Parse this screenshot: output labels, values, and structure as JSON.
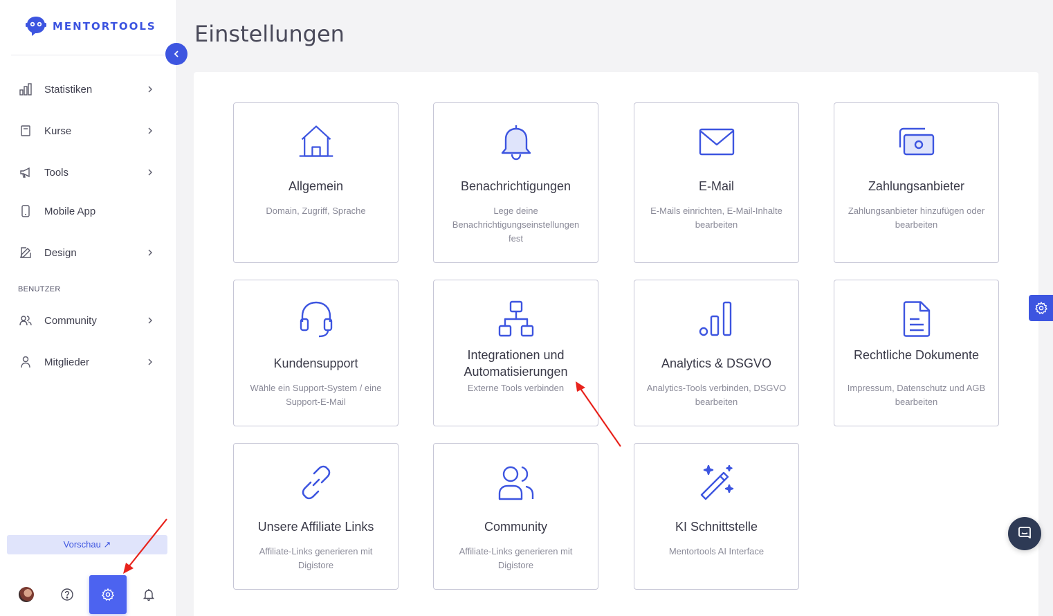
{
  "brand": {
    "name": "MENTORTOOLS",
    "accent": "#3d55e0"
  },
  "sidebar": {
    "items": [
      {
        "label": "Statistiken",
        "icon": "bar-chart-icon",
        "has_submenu": true
      },
      {
        "label": "Kurse",
        "icon": "book-icon",
        "has_submenu": true
      },
      {
        "label": "Tools",
        "icon": "megaphone-icon",
        "has_submenu": true
      },
      {
        "label": "Mobile App",
        "icon": "mobile-icon",
        "has_submenu": false
      },
      {
        "label": "Design",
        "icon": "pencil-icon",
        "has_submenu": true
      }
    ],
    "section_title": "BENUTZER",
    "user_items": [
      {
        "label": "Community",
        "icon": "users-icon",
        "has_submenu": true
      },
      {
        "label": "Mitglieder",
        "icon": "user-icon",
        "has_submenu": true
      }
    ],
    "preview_label": "Vorschau ↗"
  },
  "page": {
    "title": "Einstellungen"
  },
  "cards": [
    {
      "title": "Allgemein",
      "desc": "Domain, Zugriff, Sprache",
      "icon": "home-icon"
    },
    {
      "title": "Benachrichtigungen",
      "desc": "Lege deine Benachrichtigungseinstellungen fest",
      "icon": "bell-icon"
    },
    {
      "title": "E-Mail",
      "desc": "E-Mails einrichten, E-Mail-Inhalte bearbeiten",
      "icon": "envelope-icon"
    },
    {
      "title": "Zahlungsanbieter",
      "desc": "Zahlungsanbieter hinzufügen oder bearbeiten",
      "icon": "money-icon"
    },
    {
      "title": "Kundensupport",
      "desc": "Wähle ein Support-System / eine Support-E-Mail",
      "icon": "headset-icon"
    },
    {
      "title": "Integrationen und Automatisierungen",
      "desc": "Externe Tools verbinden",
      "icon": "sitemap-icon"
    },
    {
      "title": "Analytics & DSGVO",
      "desc": "Analytics-Tools verbinden, DSGVO bearbeiten",
      "icon": "analytics-icon"
    },
    {
      "title": "Rechtliche Dokumente",
      "desc": "Impressum, Datenschutz und AGB bearbeiten",
      "icon": "document-icon"
    },
    {
      "title": "Unsere Affiliate Links",
      "desc": "Affiliate-Links generieren mit Digistore",
      "icon": "link-icon"
    },
    {
      "title": "Community",
      "desc": "Affiliate-Links generieren mit Digistore",
      "icon": "users-icon"
    },
    {
      "title": "KI Schnittstelle",
      "desc": "Mentortools AI Interface",
      "icon": "magic-wand-icon"
    }
  ]
}
